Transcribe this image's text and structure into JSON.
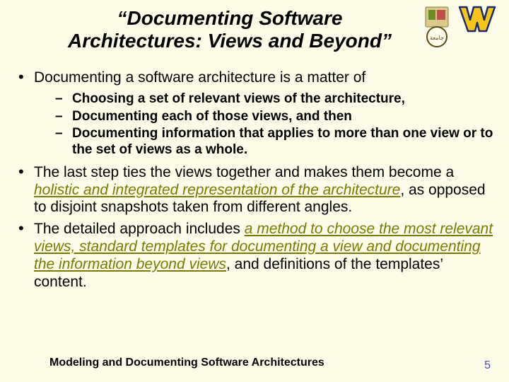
{
  "title": {
    "line1": "“Documenting Software",
    "line2": "Architectures: Views and Beyond”"
  },
  "bullets": [
    {
      "text": "Documenting a software architecture is a matter of",
      "sub": [
        "Choosing a set of relevant views of the architecture,",
        "Documenting each of those views, and then",
        "Documenting information that applies to more than one view or to the set of views as a whole."
      ]
    },
    {
      "pre": "The last step ties the views together and makes them become a ",
      "highlight": "holistic and integrated representation of the architecture",
      "post": ", as opposed to disjoint snapshots taken from different angles."
    },
    {
      "pre": "The detailed approach includes ",
      "highlight": "a method to choose the most relevant views, standard templates for documenting a view and documenting the information beyond views",
      "post": ", and definitions of the templates’ content."
    }
  ],
  "footer": "Modeling and Documenting Software Architectures",
  "page": "5",
  "colors": {
    "background": "#fcfce8",
    "highlight": "#7a7a00",
    "pagenum": "#4a4aa0"
  }
}
